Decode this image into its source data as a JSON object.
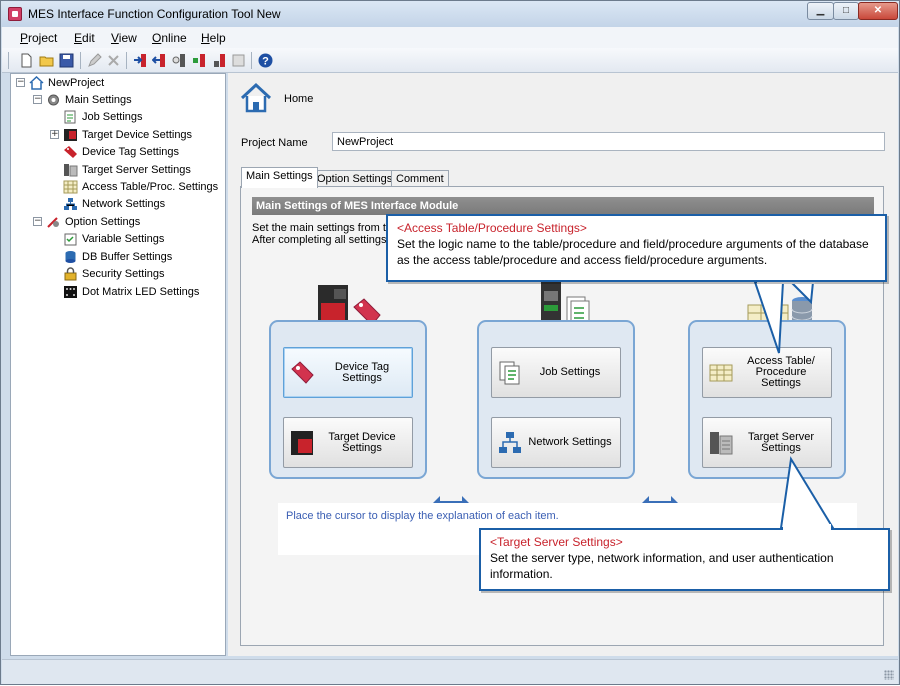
{
  "window": {
    "title": "MES Interface Function Configuration Tool New"
  },
  "menu": [
    {
      "label": "Project",
      "accel": "P"
    },
    {
      "label": "Edit",
      "accel": "E"
    },
    {
      "label": "View",
      "accel": "V"
    },
    {
      "label": "Online",
      "accel": "O"
    },
    {
      "label": "Help",
      "accel": "H"
    }
  ],
  "tree": {
    "root": "NewProject",
    "main_settings": "Main Settings",
    "job_settings": "Job Settings",
    "target_device_settings": "Target Device Settings",
    "device_tag_settings": "Device Tag Settings",
    "target_server_settings": "Target Server Settings",
    "access_table_settings": "Access Table/Proc. Settings",
    "network_settings": "Network Settings",
    "option_settings": "Option Settings",
    "variable_settings": "Variable Settings",
    "db_buffer_settings": "DB Buffer Settings",
    "security_settings": "Security Settings",
    "dot_matrix_led_settings": "Dot Matrix LED Settings"
  },
  "content": {
    "home_label": "Home",
    "project_name_label": "Project Name",
    "project_name_value": "NewProject",
    "tabs": [
      "Main Settings",
      "Option Settings",
      "Comment"
    ],
    "section_title": "Main Settings of MES Interface Module",
    "desc_line1": "Set the main settings from th",
    "desc_line2": "After completing all settings,",
    "buttons": {
      "device_tag": "Device Tag Settings",
      "target_device": "Target Device Settings",
      "job": "Job Settings",
      "network": "Network Settings",
      "access_table": "Access Table/ Procedure Settings",
      "target_server": "Target Server Settings"
    },
    "explain_text": "Place the cursor to display the explanation of each item."
  },
  "callouts": {
    "access_title": "<Access Table/Procedure Settings>",
    "access_body": "Set the logic name to the table/procedure and field/procedure arguments of the database as the access table/procedure and access field/procedure arguments.",
    "server_title": "<Target Server Settings>",
    "server_body": "Set the server type, network information, and user authentication information."
  },
  "colors": {
    "callout_border": "#1b5fa7",
    "callout_title": "#c8232c",
    "group_border": "#7aa6d4",
    "explain_text": "#3a5eb3"
  }
}
